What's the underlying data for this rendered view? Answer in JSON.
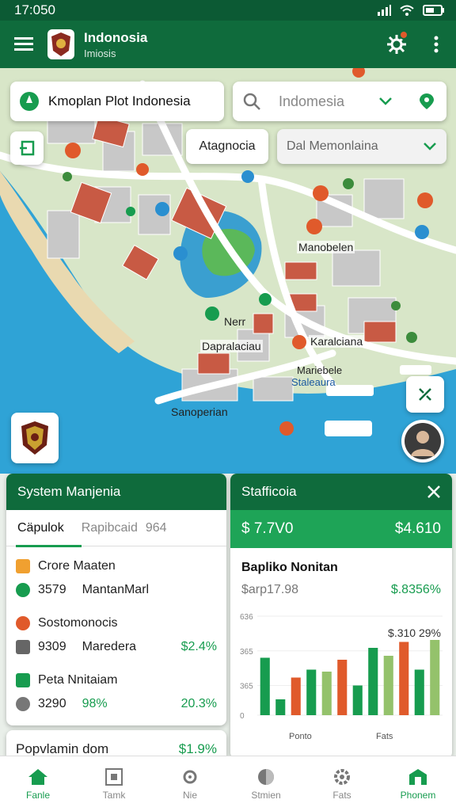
{
  "status": {
    "time": "17:050"
  },
  "appbar": {
    "title": "Indonosia",
    "subtitle": "Imiosis"
  },
  "search_card": {
    "title": "Kmoplan Plot Indonesia"
  },
  "search_input": {
    "value": "Indomesia"
  },
  "region_chip": {
    "label": "Atagnocia"
  },
  "region_select": {
    "value": "Dal Memonlaina"
  },
  "map_labels": [
    "Manobelen",
    "Nerr",
    "Dapralaciau",
    "Karalciana",
    "Sanoperian",
    "Mariebele",
    "Staleaura"
  ],
  "left_panel": {
    "title": "System Manjenia",
    "tabs": [
      "Cäpulok",
      "Rapibcaid",
      "964"
    ],
    "rows": [
      {
        "a": "Crore Maaten",
        "b": "",
        "pct": "",
        "icon": "folder",
        "color": "#f0a030"
      },
      {
        "a": "3579",
        "b": "MantanMarl",
        "pct": "",
        "icon": "pin",
        "color": "#179c4f"
      },
      {
        "a": "Sostomonocis",
        "b": "",
        "pct": "",
        "icon": "tag",
        "color": "#e05a2b"
      },
      {
        "a": "9309",
        "b": "Maredera",
        "pct": "$2.4%",
        "icon": "briefcase",
        "color": "#555"
      },
      {
        "a": "Peta Nnitaiam",
        "b": "",
        "pct": "",
        "icon": "chart",
        "color": "#179c4f"
      },
      {
        "a": "3290",
        "b": "98%",
        "pct": "20.3%",
        "icon": "clock",
        "color": "#555"
      }
    ],
    "footer_row": {
      "a": "Popvlamin dom",
      "b": "$1.9%"
    }
  },
  "right_panel": {
    "title": "Stafficoia",
    "close_icon": "close-icon",
    "stat_left": "$ 7.7V0",
    "stat_right": "$4.610",
    "chart_title": "Bapliko Nonitan",
    "sub_left": "$arp17.98",
    "sub_right": "$.8356%",
    "peak_label": "$.310 29%",
    "y_ticks": [
      "636",
      "365",
      "365",
      "0"
    ],
    "bottom_labels": [
      "Ponto",
      "Fats"
    ]
  },
  "chart_data": {
    "type": "bar",
    "title": "Bapliko Nonitan",
    "ylim": [
      0,
      100
    ],
    "values": [
      58,
      16,
      38,
      46,
      44,
      56,
      30,
      68,
      60,
      74,
      46,
      76
    ],
    "colors": [
      "#179c4f",
      "#179c4f",
      "#e05a2b",
      "#179c4f",
      "#94c26b",
      "#e05a2b",
      "#179c4f",
      "#179c4f",
      "#94c26b",
      "#e05a2b",
      "#179c4f",
      "#94c26b"
    ]
  },
  "bottomnav": [
    {
      "label": "Fanle",
      "icon": "home-icon",
      "active": false
    },
    {
      "label": "Tamk",
      "icon": "task-icon",
      "active": false
    },
    {
      "label": "Nie",
      "icon": "gear-icon",
      "active": false
    },
    {
      "label": "Stmien",
      "icon": "globe-icon",
      "active": false
    },
    {
      "label": "Fats",
      "icon": "settings-icon",
      "active": false
    },
    {
      "label": "Phonem",
      "icon": "building-icon",
      "active": true
    }
  ]
}
